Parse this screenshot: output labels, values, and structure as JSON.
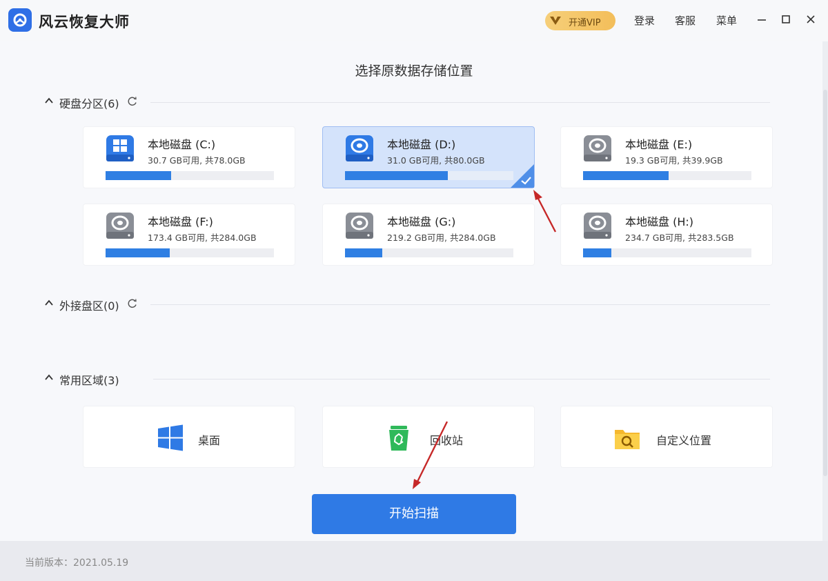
{
  "app": {
    "title": "风云恢复大师"
  },
  "titlebar": {
    "vip_label": "开通VIP",
    "login": "登录",
    "service": "客服",
    "menu": "菜单"
  },
  "heading": "选择原数据存储位置",
  "sections": {
    "disks": "硬盘分区(6)",
    "external": "外接盘区(0)",
    "common": "常用区域(3)"
  },
  "disks": [
    {
      "name": "本地磁盘 (C:)",
      "size": "30.7 GB可用, 共78.0GB",
      "free_fraction": 0.39,
      "selected": false
    },
    {
      "name": "本地磁盘 (D:)",
      "size": "31.0 GB可用, 共80.0GB",
      "free_fraction": 0.61,
      "selected": true
    },
    {
      "name": "本地磁盘 (E:)",
      "size": "19.3 GB可用, 共39.9GB",
      "free_fraction": 0.51,
      "selected": false
    },
    {
      "name": "本地磁盘 (F:)",
      "size": "173.4 GB可用, 共284.0GB",
      "free_fraction": 0.38,
      "selected": false
    },
    {
      "name": "本地磁盘 (G:)",
      "size": "219.2 GB可用, 共284.0GB",
      "free_fraction": 0.22,
      "selected": false
    },
    {
      "name": "本地磁盘 (H:)",
      "size": "234.7 GB可用, 共283.5GB",
      "free_fraction": 0.17,
      "selected": false
    }
  ],
  "areas": [
    {
      "label": "桌面",
      "icon": "windows-icon"
    },
    {
      "label": "回收站",
      "icon": "recycle-bin-icon"
    },
    {
      "label": "自定义位置",
      "icon": "folder-search-icon"
    }
  ],
  "scan_button": "开始扫描",
  "footer": {
    "version": "当前版本：2021.05.19"
  },
  "colors": {
    "accent": "#2f7ae5",
    "selected_bg": "#d4e3fb",
    "vip": "#f3be5a",
    "annotation_arrow": "#c62828"
  }
}
